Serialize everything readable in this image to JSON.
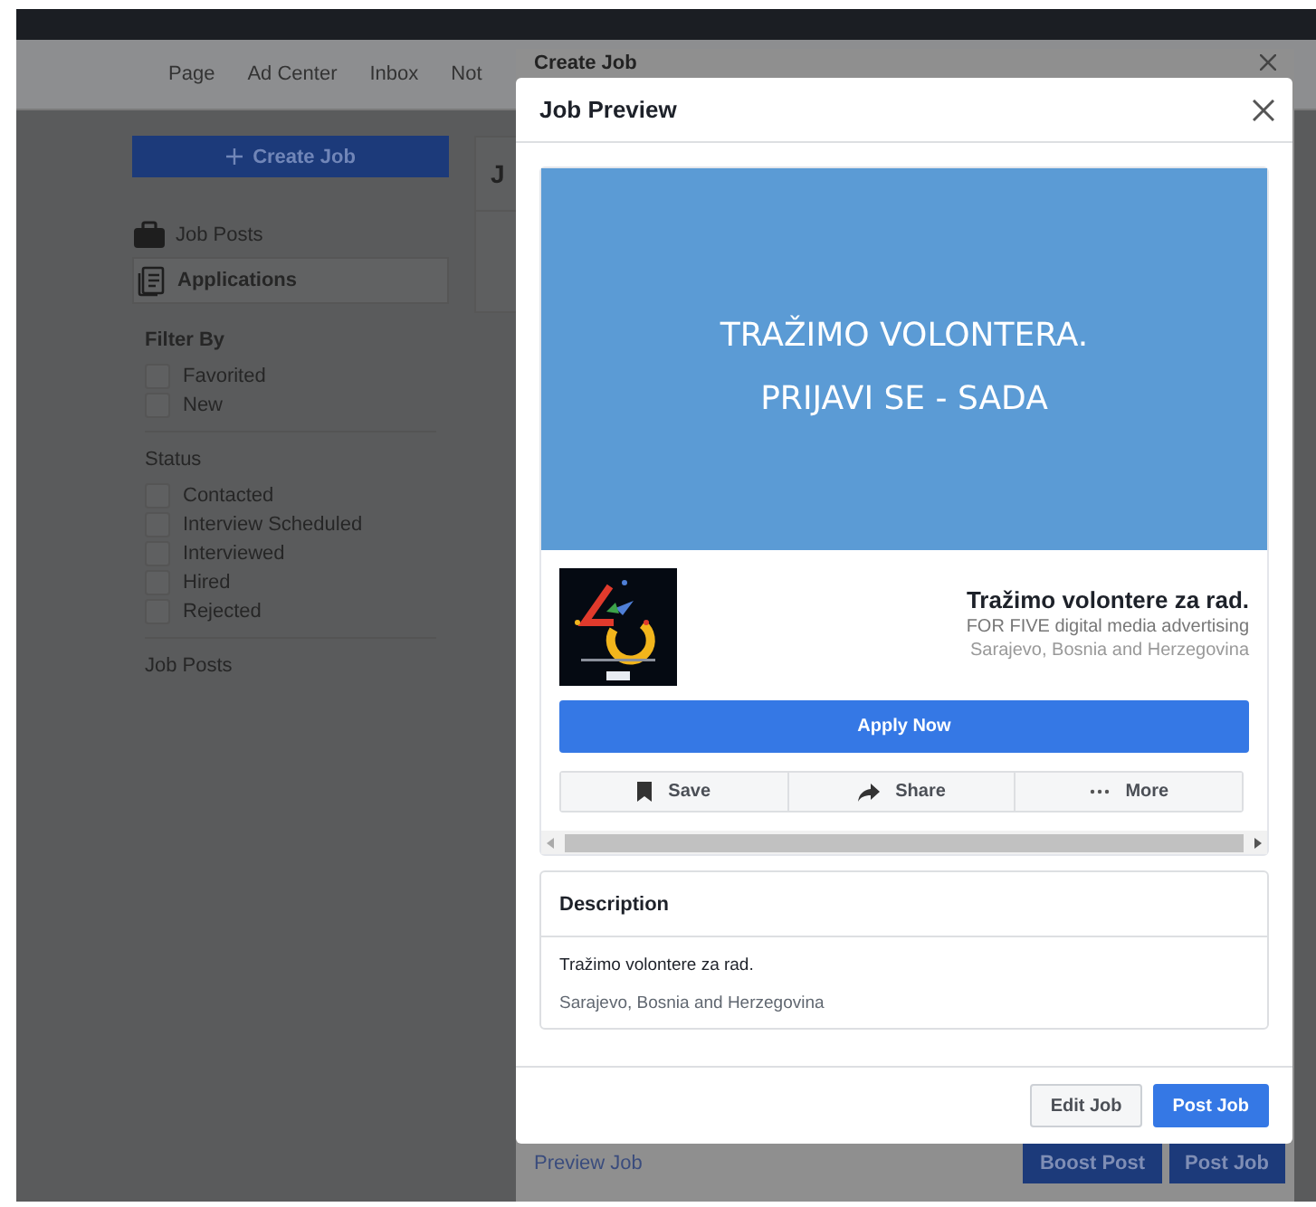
{
  "top_nav": {
    "items": [
      {
        "label": "Page"
      },
      {
        "label": "Ad Center"
      },
      {
        "label": "Inbox"
      },
      {
        "label": "Not"
      }
    ]
  },
  "sidebar": {
    "create_button": "Create Job",
    "items": [
      {
        "label": "Job Posts",
        "kind": "briefcase",
        "selected": false
      },
      {
        "label": "Applications",
        "kind": "document",
        "selected": true
      }
    ],
    "filter_title": "Filter By",
    "filters": [
      {
        "label": "Favorited",
        "checked": false
      },
      {
        "label": "New",
        "checked": false
      }
    ],
    "status_title": "Status",
    "statuses": [
      {
        "label": "Contacted",
        "checked": false
      },
      {
        "label": "Interview Scheduled",
        "checked": false
      },
      {
        "label": "Interviewed",
        "checked": false
      },
      {
        "label": "Hired",
        "checked": false
      },
      {
        "label": "Rejected",
        "checked": false
      }
    ],
    "footer": "Job Posts"
  },
  "main_card": {
    "title": "J"
  },
  "create_job_modal": {
    "title": "Create Job",
    "preview_link": "Preview Job",
    "buttons": [
      {
        "label": "Boost Post"
      },
      {
        "label": "Post Job"
      }
    ]
  },
  "job_preview": {
    "title": "Job Preview",
    "banner_lines": [
      "TRAŽIMO VOLONTERA.",
      "PRIJAVI SE - SADA"
    ],
    "logo": {
      "kind": "picture"
    },
    "job_title": "Tražimo volontere za rad.",
    "company": "FOR FIVE digital media advertising",
    "location": "Sarajevo, Bosnia and Herzegovina",
    "apply_button": "Apply Now",
    "actions": [
      {
        "label": "Save",
        "kind": "bookmark"
      },
      {
        "label": "Share",
        "kind": "share"
      },
      {
        "label": "More",
        "kind": "dots"
      }
    ],
    "description": {
      "title": "Description",
      "lines": [
        "Tražimo volontere za rad.",
        "Sarajevo, Bosnia and Herzegovina"
      ]
    },
    "buttons": [
      {
        "label": "Edit Job",
        "kind": "secondary"
      },
      {
        "label": "Post Job",
        "kind": "primary"
      }
    ]
  }
}
